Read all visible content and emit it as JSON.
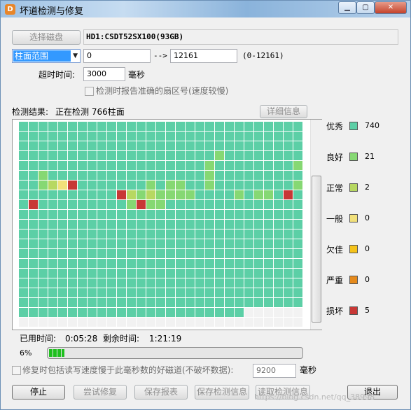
{
  "window": {
    "title": "坏道检测与修复",
    "app_icon": "disk-genius-icon",
    "min_glyph": "▁",
    "max_glyph": "▢",
    "close_glyph": "✕"
  },
  "disk": {
    "select_button": "选择磁盘",
    "info": "HD1:CSDT52SX100(93GB)"
  },
  "range": {
    "mode": "柱面范围",
    "start": "0",
    "arrow": "-->",
    "end": "12161",
    "hint": "(0-12161)"
  },
  "timeout": {
    "label": "超时时间:",
    "value": "3000",
    "unit": "毫秒"
  },
  "report_sector": {
    "label": "检测时报告准确的扇区号(速度较慢)",
    "checked": false
  },
  "result": {
    "label": "检测结果:",
    "status": "正在检测 766柱面",
    "details_button": "详细信息"
  },
  "colors": {
    "优秀": "#5ccfa6",
    "良好": "#86d873",
    "正常": "#b7d861",
    "一般": "#f1e07a",
    "欠佳": "#f5c31a",
    "严重": "#e58a1c",
    "损坏": "#c83836",
    "empty": "#f2f2f2"
  },
  "grid": {
    "cols": 29,
    "rows": 21,
    "filled": 574,
    "marks": [
      [
        3,
        20,
        "良好"
      ],
      [
        4,
        19,
        "良好"
      ],
      [
        4,
        28,
        "良好"
      ],
      [
        5,
        2,
        "良好"
      ],
      [
        5,
        19,
        "良好"
      ],
      [
        6,
        2,
        "良好"
      ],
      [
        6,
        3,
        "正常"
      ],
      [
        6,
        4,
        "一般"
      ],
      [
        6,
        5,
        "损坏"
      ],
      [
        6,
        13,
        "良好"
      ],
      [
        6,
        15,
        "良好"
      ],
      [
        6,
        16,
        "良好"
      ],
      [
        6,
        19,
        "良好"
      ],
      [
        6,
        28,
        "良好"
      ],
      [
        7,
        10,
        "损坏"
      ],
      [
        7,
        11,
        "正常"
      ],
      [
        7,
        12,
        "良好"
      ],
      [
        7,
        13,
        "正常"
      ],
      [
        7,
        14,
        "良好"
      ],
      [
        7,
        15,
        "良好"
      ],
      [
        7,
        16,
        "良好"
      ],
      [
        7,
        17,
        "良好"
      ],
      [
        7,
        22,
        "良好"
      ],
      [
        7,
        24,
        "良好"
      ],
      [
        7,
        25,
        "良好"
      ],
      [
        7,
        27,
        "损坏"
      ],
      [
        8,
        1,
        "损坏"
      ],
      [
        8,
        11,
        "良好"
      ],
      [
        8,
        12,
        "损坏"
      ],
      [
        8,
        13,
        "良好"
      ],
      [
        8,
        14,
        "良好"
      ]
    ]
  },
  "legend": [
    {
      "label": "优秀",
      "count": "740"
    },
    {
      "label": "良好",
      "count": "21"
    },
    {
      "label": "正常",
      "count": "2"
    },
    {
      "label": "一般",
      "count": "0"
    },
    {
      "label": "欠佳",
      "count": "0"
    },
    {
      "label": "严重",
      "count": "0"
    },
    {
      "label": "损坏",
      "count": "5"
    }
  ],
  "time": {
    "used_label": "已用时间:",
    "used": "0:05:28",
    "remain_label": "剩余时间:",
    "remain": "1:21:19"
  },
  "progress": {
    "text": "6%",
    "fraction": 0.06
  },
  "repair_option": {
    "label": "修复时包括读写速度慢于此毫秒数的好磁道(不破坏数据):",
    "value": "9200",
    "unit": "毫秒",
    "checked": false
  },
  "buttons": {
    "stop": "停止",
    "try_repair": "尝试修复",
    "save_report": "保存报表",
    "save_info": "保存检测信息",
    "load_info": "读取检测信息",
    "exit": "退出"
  },
  "watermark": "https://blog.csdn.net/qq_38998"
}
